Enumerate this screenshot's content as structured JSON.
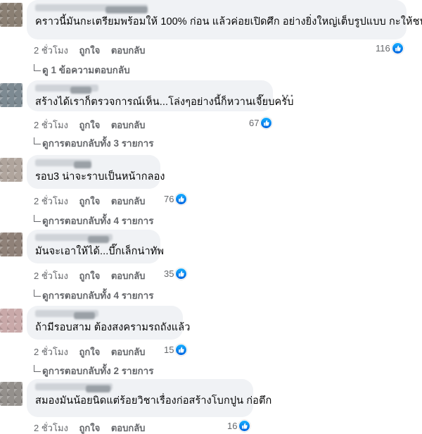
{
  "comments": [
    {
      "text": "คราวนี้มันกะเตรียมพร้อมให้ 100% ก่อน แล้วค่อยเปิดศึก อย่างยิ่งใหญ่เต็บรูปแบบ กะให้ชนะ",
      "time": "2 ชั่วโมง",
      "like": "ถูกใจ",
      "reply": "ตอบกลับ",
      "reactions": "116",
      "replies": "ดู 1 ข้อความตอบกลับ"
    },
    {
      "text": "สร้างได้เราก็ตรวจการณ์เห็น...โล่งๆอย่างนี้ก็หวานเจี๊ยบครับ",
      "time": "2 ชั่วโมง",
      "like": "ถูกใจ",
      "reply": "ตอบกลับ",
      "reactions": "67",
      "replies": "ดูการตอบกลับทั้ง 3 รายการ",
      "more": "···"
    },
    {
      "text": "รอบ3 น่าจะราบเป็นหน้ากลอง",
      "time": "2 ชั่วโมง",
      "like": "ถูกใจ",
      "reply": "ตอบกลับ",
      "reactions": "76",
      "replies": "ดูการตอบกลับทั้ง 4 รายการ"
    },
    {
      "text": "มันจะเอาให้ได้...บึ๊กเล็กน่าทัพ",
      "time": "2 ชั่วโมง",
      "like": "ถูกใจ",
      "reply": "ตอบกลับ",
      "reactions": "35",
      "replies": "ดูการตอบกลับทั้ง 4 รายการ"
    },
    {
      "text": "ถ้ามีรอบสาม ต้องสงครามรถถังแล้ว",
      "time": "2 ชั่วโมง",
      "like": "ถูกใจ",
      "reply": "ตอบกลับ",
      "reactions": "15",
      "replies": "ดูการตอบกลับทั้ง 2 รายการ"
    },
    {
      "text": "สมองมันน้อยนิดแต่ร้อยวิชาเรื่องก่อสร้างโบกปูน ก่อตึก",
      "time": "2 ชั่วโมง",
      "like": "ถูกใจ",
      "reply": "ตอบกลับ",
      "reactions": "16"
    }
  ],
  "colors": {
    "bubble": "#f0f2f5",
    "meta": "#65676b",
    "like_blue": "#0866ff",
    "avatars": [
      "#8a7f73",
      "#7d8a92",
      "#b0a59d",
      "#8f8178",
      "#c9a9a9",
      "#94908c"
    ]
  },
  "icons": {
    "like": "thumbs-up-icon",
    "reply_arrow": "reply-arrow-icon",
    "more": "more-options-icon"
  }
}
